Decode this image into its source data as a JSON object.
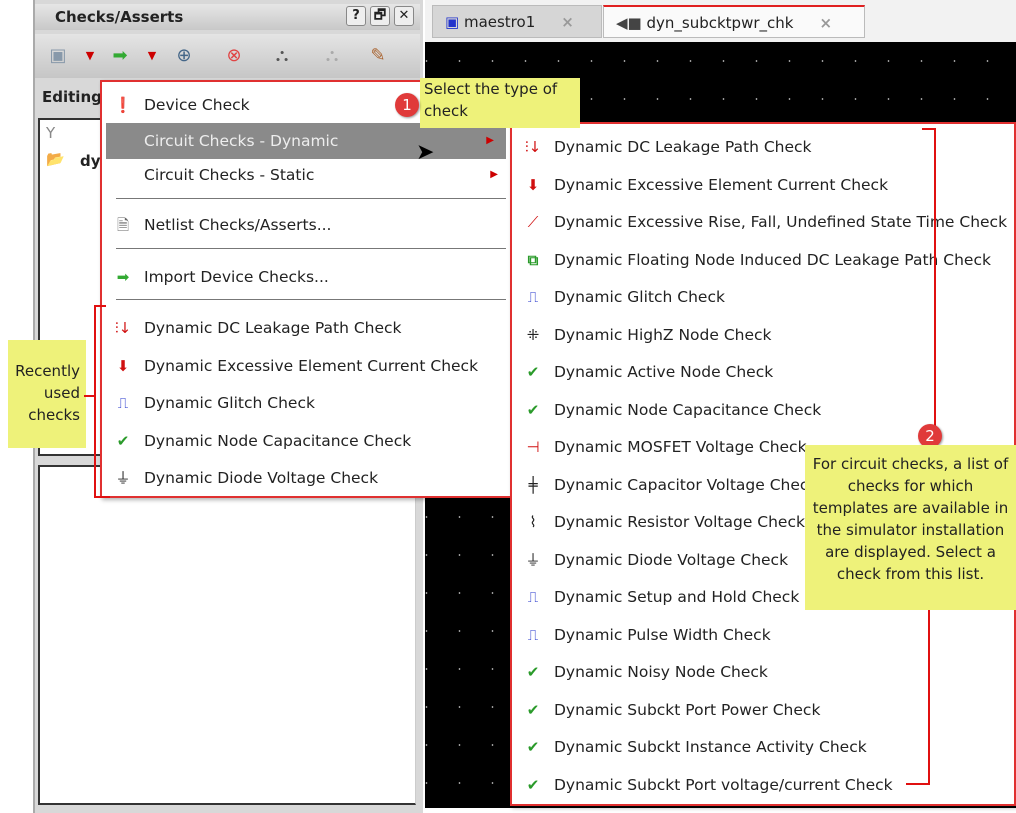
{
  "panel": {
    "title": "Checks/Asserts",
    "help": "?",
    "float": "🗗",
    "close": "✕",
    "editing_label": "Editing",
    "tree_item": "dy"
  },
  "toolbar": {
    "icons": [
      "save-icon",
      "dropdown-icon",
      "import-icon",
      "dropdown-icon",
      "fit-icon",
      "delete-icon",
      "hierarchy-icon",
      "hierarchy-disabled-icon",
      "edit-icon"
    ]
  },
  "tabs": [
    {
      "label": "maestro1",
      "close": "×",
      "active": false
    },
    {
      "label": "dyn_subcktpwr_chk",
      "close": "×",
      "active": true
    }
  ],
  "menu": {
    "device_check": "Device Check",
    "dynamic": "Circuit Checks - Dynamic",
    "static": "Circuit Checks - Static",
    "netlist": "Netlist Checks/Asserts...",
    "import": "Import Device Checks...",
    "recent": [
      "Dynamic DC Leakage Path Check",
      "Dynamic Excessive Element Current Check",
      "Dynamic Glitch Check",
      "Dynamic Node Capacitance Check",
      "Dynamic Diode Voltage Check"
    ]
  },
  "submenu": [
    "Dynamic DC Leakage Path Check",
    "Dynamic Excessive Element Current Check",
    "Dynamic Excessive Rise, Fall, Undefined State Time Check",
    "Dynamic Floating Node Induced DC Leakage Path Check",
    "Dynamic Glitch Check",
    "Dynamic HighZ Node Check",
    "Dynamic Active Node Check",
    "Dynamic Node Capacitance Check",
    "Dynamic MOSFET Voltage Check",
    "Dynamic Capacitor Voltage Check",
    "Dynamic Resistor Voltage Check",
    "Dynamic Diode Voltage Check",
    "Dynamic Setup and Hold Check",
    "Dynamic Pulse Width Check",
    "Dynamic Noisy Node Check",
    "Dynamic Subckt Port Power Check",
    "Dynamic Subckt Instance Activity Check",
    "Dynamic Subckt Port voltage/current Check"
  ],
  "annotations": {
    "n1": "1",
    "note1": "Select the type of check",
    "n2": "2",
    "note2": "For circuit checks, a list of checks for which templates are available in the simulator installation are displayed. Select a check from this list.",
    "recent": "Recently used checks"
  },
  "colors": {
    "menu_border": "#e03030",
    "note_bg": "#eef27a",
    "highlight": "#8a8a8a",
    "check_green": "#2a9a2a"
  }
}
